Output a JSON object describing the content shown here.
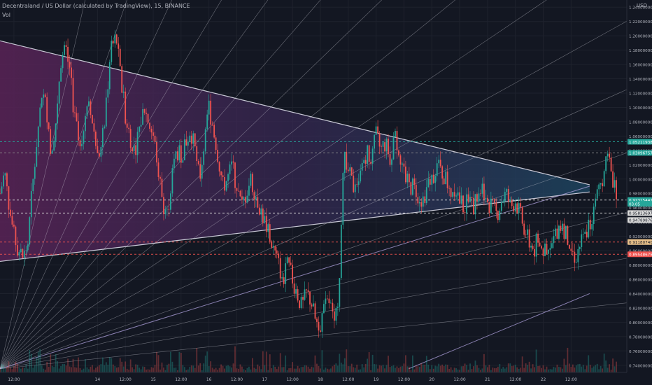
{
  "header": {
    "title": "Decentraland / US Dollar (calculated by TradingView), 15, BINANCE",
    "indicator": "Vol",
    "currency": "USD"
  },
  "colors": {
    "background": "#131722",
    "up": "#26a69a",
    "down": "#ef5350",
    "wedge_top": "#7b2f6f",
    "wedge_bottom": "#1b4f72",
    "trendline": "#c9c9d6",
    "fan": "#d6d6e0"
  },
  "chart_data": {
    "type": "candlestick",
    "symbol": "MANAUSD",
    "interval": "15",
    "exchange": "BINANCE",
    "y_axis": {
      "min": 0.73,
      "max": 1.25,
      "ticks": [
        "1.24000000",
        "1.22000000",
        "1.20000000",
        "1.18000000",
        "1.16000000",
        "1.14000000",
        "1.12000000",
        "1.10000000",
        "1.08000000",
        "1.06000000",
        "1.04000000",
        "1.02000000",
        "1.00000000",
        "0.98000000",
        "0.96000000",
        "0.94000000",
        "0.92000000",
        "0.90000000",
        "0.88000000",
        "0.86000000",
        "0.84000000",
        "0.82000000",
        "0.80000000",
        "0.78000000",
        "0.76000000",
        "0.74000000"
      ],
      "tick_values": [
        1.24,
        1.22,
        1.2,
        1.18,
        1.16,
        1.14,
        1.12,
        1.1,
        1.08,
        1.06,
        1.04,
        1.02,
        1.0,
        0.98,
        0.96,
        0.94,
        0.92,
        0.9,
        0.88,
        0.86,
        0.84,
        0.82,
        0.8,
        0.78,
        0.76,
        0.74
      ]
    },
    "x_axis": {
      "labels": [
        "12:00",
        "14",
        "12:00",
        "15",
        "12:00",
        "16",
        "12:00",
        "17",
        "12:00",
        "18",
        "12:00",
        "19",
        "12:00",
        "20",
        "12:00",
        "21",
        "12:00",
        "22",
        "12:00"
      ],
      "label_hours": [
        -36,
        0,
        12,
        24,
        36,
        48,
        60,
        72,
        84,
        96,
        108,
        120,
        132,
        144,
        156,
        168,
        180,
        192,
        204
      ]
    },
    "price_labels": [
      {
        "text": "1.05211938",
        "value": 1.0521,
        "color": "#26a69a"
      },
      {
        "text": "1.03096757",
        "value": 1.0365,
        "color": "#26a69a"
      },
      {
        "text": "0.97315442",
        "value": 0.9707,
        "color": "#26a69a"
      },
      {
        "text": "03:05",
        "value": 0.9655,
        "color": "#26a69a"
      },
      {
        "text": "0.95813697",
        "value": 0.9525,
        "color": "#d9d9d9"
      },
      {
        "text": "0.94789876",
        "value": 0.9427,
        "color": "#d9d9d9"
      },
      {
        "text": "0.91180740",
        "value": 0.912,
        "color": "#e8c08a"
      },
      {
        "text": "0.89548675",
        "value": 0.895,
        "color": "#ef5350"
      }
    ],
    "horizontal_levels": [
      {
        "value": 1.0521,
        "color": "#26a69a"
      },
      {
        "value": 1.0365,
        "color": "#8e8e8e"
      },
      {
        "value": 0.9707,
        "color": "#d9d9d9"
      },
      {
        "value": 0.9525,
        "color": "#d9d9d9"
      },
      {
        "value": 0.912,
        "color": "#ef5350"
      },
      {
        "value": 0.895,
        "color": "#ef5350"
      }
    ],
    "wedge": {
      "upper": [
        [
          -42,
          1.193
        ],
        [
          212,
          0.992
        ]
      ],
      "lower": [
        [
          -42,
          0.885
        ],
        [
          212,
          0.982
        ]
      ]
    },
    "fan_origin": [
      -42,
      0.735
    ],
    "fan_angles": [
      6,
      10,
      14,
      19,
      24,
      29,
      34,
      39,
      44,
      49,
      54,
      59,
      65,
      71,
      77
    ],
    "extra_lines": [
      {
        "from": [
          134,
          0.735
        ],
        "to": [
          212,
          0.84
        ]
      },
      {
        "from": [
          -42,
          0.735
        ],
        "to": [
          212,
          0.99
        ]
      }
    ],
    "series_close": [
      [
        -42,
        0.98
      ],
      [
        -40,
        1.01
      ],
      [
        -38,
        0.96
      ],
      [
        -36,
        0.92
      ],
      [
        -34,
        0.9
      ],
      [
        -32,
        0.89
      ],
      [
        -30,
        0.91
      ],
      [
        -28,
        0.99
      ],
      [
        -26,
        1.06
      ],
      [
        -24,
        1.12
      ],
      [
        -22,
        1.1
      ],
      [
        -20,
        1.04
      ],
      [
        -18,
        1.08
      ],
      [
        -16,
        1.16
      ],
      [
        -14,
        1.19
      ],
      [
        -12,
        1.15
      ],
      [
        -10,
        1.09
      ],
      [
        -8,
        1.05
      ],
      [
        -6,
        1.07
      ],
      [
        -4,
        1.1
      ],
      [
        -2,
        1.08
      ],
      [
        0,
        1.03
      ],
      [
        2,
        1.05
      ],
      [
        4,
        1.12
      ],
      [
        6,
        1.18
      ],
      [
        8,
        1.2
      ],
      [
        10,
        1.14
      ],
      [
        12,
        1.09
      ],
      [
        14,
        1.06
      ],
      [
        16,
        1.04
      ],
      [
        18,
        1.07
      ],
      [
        20,
        1.1
      ],
      [
        22,
        1.08
      ],
      [
        24,
        1.06
      ],
      [
        26,
        1.02
      ],
      [
        28,
        0.97
      ],
      [
        30,
        0.95
      ],
      [
        32,
        1.0
      ],
      [
        34,
        1.04
      ],
      [
        36,
        1.03
      ],
      [
        38,
        1.05
      ],
      [
        40,
        1.07
      ],
      [
        42,
        1.04
      ],
      [
        44,
        1.0
      ],
      [
        46,
        1.05
      ],
      [
        48,
        1.1
      ],
      [
        50,
        1.07
      ],
      [
        52,
        1.03
      ],
      [
        54,
        0.99
      ],
      [
        56,
        1.0
      ],
      [
        58,
        1.02
      ],
      [
        60,
        0.99
      ],
      [
        62,
        0.96
      ],
      [
        64,
        0.98
      ],
      [
        66,
        1.0
      ],
      [
        68,
        0.98
      ],
      [
        70,
        0.96
      ],
      [
        72,
        0.94
      ],
      [
        74,
        0.92
      ],
      [
        76,
        0.9
      ],
      [
        78,
        0.88
      ],
      [
        80,
        0.86
      ],
      [
        82,
        0.88
      ],
      [
        84,
        0.86
      ],
      [
        86,
        0.84
      ],
      [
        88,
        0.82
      ],
      [
        90,
        0.84
      ],
      [
        92,
        0.83
      ],
      [
        94,
        0.8
      ],
      [
        96,
        0.8
      ],
      [
        98,
        0.82
      ],
      [
        100,
        0.83
      ],
      [
        102,
        0.79
      ],
      [
        104,
        0.85
      ],
      [
        106,
        1.04
      ],
      [
        108,
        1.01
      ],
      [
        110,
        0.99
      ],
      [
        112,
        0.98
      ],
      [
        114,
        1.02
      ],
      [
        116,
        1.04
      ],
      [
        118,
        1.03
      ],
      [
        120,
        1.06
      ],
      [
        122,
        1.04
      ],
      [
        124,
        1.05
      ],
      [
        126,
        1.03
      ],
      [
        128,
        1.06
      ],
      [
        130,
        1.04
      ],
      [
        132,
        1.01
      ],
      [
        134,
        0.99
      ],
      [
        136,
        0.99
      ],
      [
        138,
        0.98
      ],
      [
        140,
        0.97
      ],
      [
        142,
        0.99
      ],
      [
        144,
        1.0
      ],
      [
        146,
        1.02
      ],
      [
        148,
        1.01
      ],
      [
        150,
        1.0
      ],
      [
        152,
        0.98
      ],
      [
        154,
        0.99
      ],
      [
        156,
        0.97
      ],
      [
        158,
        0.96
      ],
      [
        160,
        0.97
      ],
      [
        162,
        0.96
      ],
      [
        164,
        0.98
      ],
      [
        166,
        0.99
      ],
      [
        168,
        0.97
      ],
      [
        170,
        0.96
      ],
      [
        172,
        0.95
      ],
      [
        174,
        0.97
      ],
      [
        176,
        0.98
      ],
      [
        178,
        0.96
      ],
      [
        180,
        0.97
      ],
      [
        182,
        0.95
      ],
      [
        184,
        0.93
      ],
      [
        186,
        0.91
      ],
      [
        188,
        0.9
      ],
      [
        190,
        0.92
      ],
      [
        192,
        0.9
      ],
      [
        194,
        0.89
      ],
      [
        196,
        0.91
      ],
      [
        198,
        0.93
      ],
      [
        200,
        0.94
      ],
      [
        202,
        0.92
      ],
      [
        204,
        0.9
      ],
      [
        206,
        0.89
      ],
      [
        208,
        0.91
      ],
      [
        210,
        0.92
      ],
      [
        212,
        0.94
      ],
      [
        214,
        0.96
      ],
      [
        216,
        0.98
      ],
      [
        218,
        1.01
      ],
      [
        220,
        1.03
      ],
      [
        222,
        1.0
      ],
      [
        224,
        0.98
      ]
    ]
  }
}
